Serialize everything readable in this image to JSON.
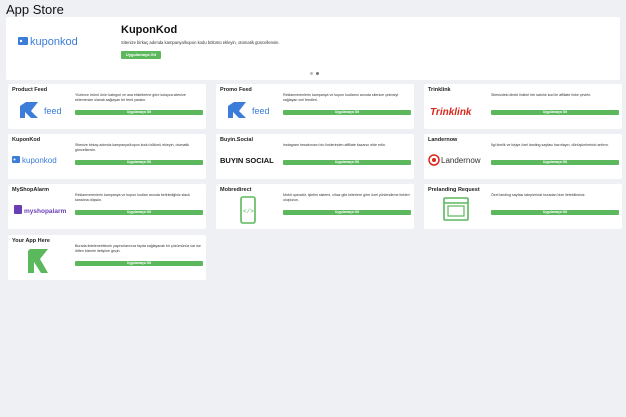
{
  "header": {
    "title": "App Store"
  },
  "hero": {
    "title": "KuponKod",
    "description": "Sitenize birkaç adımda kampanya/kupon kodu bölümü ekleyin, otomatik güncellensin.",
    "button": "Uygulamaya Git",
    "logo_text": "kuponkod"
  },
  "cards": [
    {
      "title": "Product Feed",
      "description": "Yüzlerce ürünü ürün kategori ve ana etiketlerine göre kolayca sitenize eklemenize olanak sağlayan bir feed yaratın.",
      "button": "Uygulamaya Git",
      "logo": "feed"
    },
    {
      "title": "Promo Feed",
      "description": "Reklamverenlerin kampanya ve kupon kodlarını anında sitenize çekmeyi sağlayan xml feedleri.",
      "button": "Uygulamaya Git",
      "logo": "feed"
    },
    {
      "title": "Trinklink",
      "description": "Sitenizdeki direkt linkleri tek satırlık kod ile affiliate linke çevirin.",
      "button": "Uygulamaya Git",
      "logo": "Trinklink"
    },
    {
      "title": "KuponKod",
      "description": "Sitenize birkaç adımda kampanya/kupon kodu bölümü ekleyin, otomatik güncellensin.",
      "button": "Uygulamaya Git",
      "logo": "kuponkod"
    },
    {
      "title": "Buyin.Social",
      "description": "Instagram hesabınızın bio linklerinden affiliate kazancı elde edin.",
      "button": "Uygulamaya Git",
      "logo": "BUYIN SOCIAL"
    },
    {
      "title": "Landernow",
      "description": "İlgi kimlik ve kişiye özel landing sayfası hazırlayın, dönüşümlerinizi arttırın.",
      "button": "Uygulamaya Git",
      "logo": "Landernow"
    },
    {
      "title": "MyShopAlarm",
      "description": "Reklamverenlerin kampanya ve kupon kodları anında belirlediğiniz slack kanalına düşsün.",
      "button": "Uygulamaya Git",
      "logo": "myshopalarm"
    },
    {
      "title": "Mobredirect",
      "description": "Mobil operatör, işletim sistemi, cihaz gibi kriterlere göre özel yönlendirme linkleri oluşturun.",
      "button": "Uygulamaya Git",
      "logo": "mobile"
    },
    {
      "title": "Prelanding Request",
      "description": "Özel landing sayfası taleplerinizi buradan bize iletebilirsiniz.",
      "button": "Uygulamaya Git",
      "logo": "browser"
    },
    {
      "title": "Your App Here",
      "description": "Burada listelenebilecek yayıncılarınıza fayda sağlayacak bir çözümünüz var ise lütfen bizimle iletişime geçin.",
      "button": "Uygulamaya Git",
      "logo": "R"
    }
  ],
  "colors": {
    "accent": "#5cb85c",
    "brand_blue": "#3b7dd8",
    "trinklink_red": "#d9261c"
  }
}
